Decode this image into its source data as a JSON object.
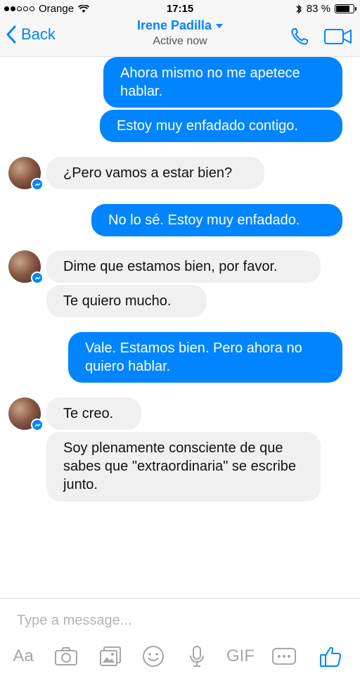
{
  "status_bar": {
    "carrier": "Orange",
    "time": "17:15",
    "battery_percent": "83 %",
    "battery_level": 0.83
  },
  "header": {
    "back_label": "Back",
    "contact_name": "Irene Padilla",
    "status": "Active now"
  },
  "messages": [
    {
      "direction": "out",
      "text": "Ahora mismo no me apetece hablar."
    },
    {
      "direction": "out",
      "text": "Estoy muy enfadado contigo."
    },
    {
      "direction": "in",
      "text": "¿Pero vamos a estar bien?"
    },
    {
      "direction": "out",
      "text": "No lo sé. Estoy muy enfadado."
    },
    {
      "direction": "in",
      "text": "Dime que estamos bien, por favor."
    },
    {
      "direction": "in",
      "text": "Te quiero mucho."
    },
    {
      "direction": "out",
      "text": "Vale. Estamos bien. Pero ahora no quiero hablar."
    },
    {
      "direction": "in",
      "text": "Te creo."
    },
    {
      "direction": "in",
      "text": "Soy plenamente consciente de que sabes que \"extraordinaria\" se escribe junto."
    }
  ],
  "composer": {
    "placeholder": "Type a message...",
    "text_format_label": "Aa",
    "gif_label": "GIF"
  },
  "colors": {
    "accent": "#0084ff",
    "incoming_bubble": "#f1f0f0",
    "toolbar_icon": "#a6a6a6"
  },
  "icons": [
    "back-chevron-icon",
    "phone-icon",
    "video-camera-icon",
    "camera-icon",
    "gallery-icon",
    "emoji-icon",
    "microphone-icon",
    "more-icon",
    "thumbs-up-icon",
    "messenger-badge-icon"
  ]
}
